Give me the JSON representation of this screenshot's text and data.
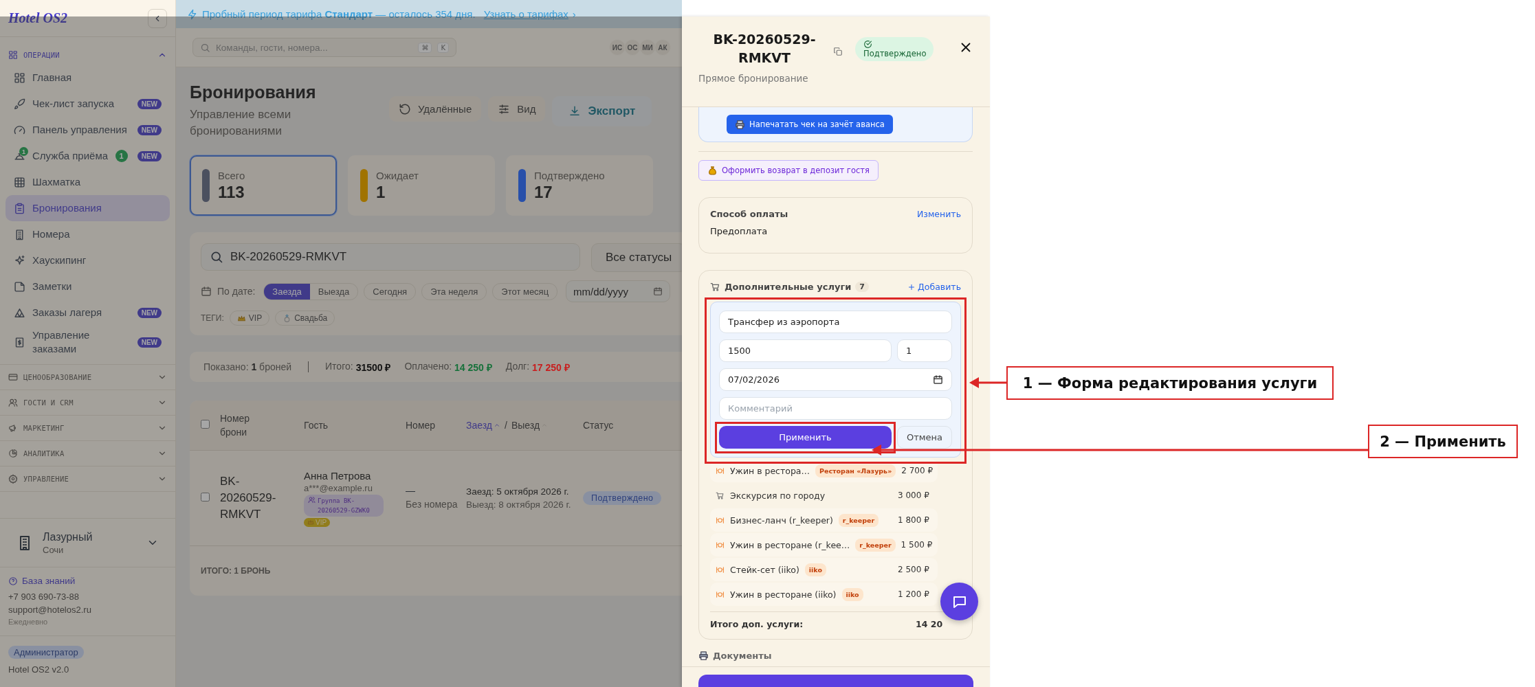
{
  "sidebar": {
    "logo": "Hotel OS2",
    "sections": [
      {
        "title": "ОПЕРАЦИИ",
        "expanded": true,
        "items": [
          {
            "label": "Главная",
            "selected": false
          },
          {
            "label": "Чек-лист запуска",
            "selected": false,
            "badge": "NEW"
          },
          {
            "label": "Панель управления",
            "selected": false,
            "badge": "NEW"
          },
          {
            "label": "Служба приёма",
            "selected": false,
            "icon_count": "1",
            "count": "1",
            "badge": "NEW"
          },
          {
            "label": "Шахматка",
            "selected": false
          },
          {
            "label": "Бронирования",
            "selected": true
          },
          {
            "label": "Номера",
            "selected": false
          },
          {
            "label": "Хаускипинг",
            "selected": false
          },
          {
            "label": "Заметки",
            "selected": false
          },
          {
            "label": "Заказы лагеря",
            "selected": false,
            "badge": "NEW"
          },
          {
            "label": "Управление заказами",
            "selected": false,
            "badge": "NEW"
          }
        ]
      },
      {
        "title": "ЦЕНООБРАЗОВАНИЕ",
        "expanded": false
      },
      {
        "title": "ГОСТИ И CRM",
        "expanded": false
      },
      {
        "title": "МАРКЕТИНГ",
        "expanded": false
      },
      {
        "title": "АНАЛИТИКА",
        "expanded": false
      },
      {
        "title": "УПРАВЛЕНИЕ",
        "expanded": false
      }
    ],
    "hotel": {
      "name": "Лазурный",
      "city": "Сочи"
    },
    "support": {
      "link": "База знаний",
      "phone": "+7 903 690-73-88",
      "email": "support@hotelos2.ru",
      "hours": "Ежедневно"
    },
    "role": "Администратор",
    "version": "Hotel OS2 v2.0"
  },
  "banner": {
    "text": "Пробный период тарифа **Стандарт** — осталось 354 дня.",
    "link": "Узнать о тарифах",
    "link_arrow": "›"
  },
  "topbar": {
    "search_placeholder": "Команды, гости, номера...",
    "shortcut": [
      "⌘",
      "K"
    ],
    "avatars": [
      "ИС",
      "ОС",
      "МИ",
      "АК"
    ]
  },
  "page": {
    "title": "Бронирования",
    "subtitle": "Управление всеми бронированиями",
    "actions": [
      {
        "label": "Удалённые",
        "kind": "secondary"
      },
      {
        "label": "Вид",
        "kind": "secondary"
      },
      {
        "label": "Экспорт",
        "kind": "primary"
      }
    ]
  },
  "stats": [
    {
      "label": "Всего",
      "value": "113",
      "color": "#4b505f",
      "selected": true
    },
    {
      "label": "Ожидает",
      "value": "1",
      "color": "#a07300",
      "selected": false
    },
    {
      "label": "Подтверждено",
      "value": "17",
      "color": "#2850aa",
      "selected": false
    }
  ],
  "filters": {
    "search_value": "BK-20260529-RMKVT",
    "status_select": "Все статусы",
    "date_label": "По дате:",
    "date_modes": [
      {
        "label": "Заезда",
        "selected": true
      },
      {
        "label": "Выезда",
        "selected": false
      }
    ],
    "quick_ranges": [
      {
        "label": "Сегодня",
        "selected": false
      },
      {
        "label": "Эта неделя",
        "selected": false
      },
      {
        "label": "Этот месяц",
        "selected": false
      }
    ],
    "date_placeholder": "mm/dd/yyyy",
    "tags_label": "ТЕГИ:",
    "tags": [
      "VIP",
      "Свадьба"
    ]
  },
  "summary": {
    "shown": "Показано: **1** броней",
    "totals": [
      {
        "label": "Итого:",
        "value": "31500 ₽",
        "color": "#111111"
      },
      {
        "label": "Оплачено:",
        "value": "14 250 ₽",
        "color": "#16713a"
      },
      {
        "label": "Долг:",
        "value": "17 250 ₽",
        "color": "#c81e1e"
      }
    ]
  },
  "table": {
    "select_all": {
      "checked": false
    },
    "columns": [
      "Номер брони",
      "Гость",
      "Номер"
    ],
    "date_sort": {
      "columns": [
        {
          "label": "Заезд",
          "selected": true
        },
        {
          "label": "Выезд",
          "selected": false
        }
      ],
      "separator": "/"
    },
    "status_column": "Статус",
    "rows": [
      {
        "checked": false,
        "booking": "BK-20260529-RMKVT",
        "guest": "Анна Петрова",
        "email": "a***@example.ru",
        "group": "Группа BK-20260529-GZWK0",
        "tags": [
          "VIP"
        ],
        "room": "—",
        "room_note": "Без номера",
        "checkin": "Заезд: 5 октября 2026 г.",
        "checkout": "Выезд: 8 октября 2026 г.",
        "status": "Подтверждено"
      }
    ],
    "footer": "ИТОГО: 1 БРОНЬ"
  },
  "drawer": {
    "title": "BK-20260529-RMKVT",
    "status": "Подтверждено",
    "subtitle": "Прямое бронирование",
    "print_button": "Напечатать чек на зачёт аванса",
    "refund_button": "Оформить возврат в депозит гостя",
    "payment": {
      "title": "Способ оплаты",
      "action": "Изменить",
      "value": "Предоплата"
    },
    "services": {
      "title": "Дополнительные услуги",
      "count": "7",
      "add": "Добавить",
      "edit_form": {
        "name": "Трансфер из аэропорта",
        "price": "1500",
        "quantity": "1",
        "date": "07/02/2026",
        "comment_placeholder": "Комментарий",
        "apply": "Применить",
        "cancel": "Отмена"
      },
      "items": [
        {
          "kind": "restaurant",
          "name": "Ужин в рестора…",
          "tag": "Ресторан «Лазурь»",
          "price": "2 700 ₽"
        },
        {
          "kind": "cart",
          "name": "Экскурсия по городу",
          "price": "3 000 ₽"
        },
        {
          "kind": "restaurant",
          "name": "Бизнес-ланч (r_keeper)",
          "tag": "r_keeper",
          "price": "1 800 ₽"
        },
        {
          "kind": "restaurant",
          "name": "Ужин в ресторане (r_kee…",
          "tag": "r_keeper",
          "price": "1 500 ₽"
        },
        {
          "kind": "restaurant",
          "name": "Стейк-сет (iiko)",
          "tag": "iiko",
          "price": "2 500 ₽"
        },
        {
          "kind": "restaurant",
          "name": "Ужин в ресторане (iiko)",
          "tag": "iiko",
          "price": "1 200 ₽"
        }
      ],
      "total_label": "Итого доп. услуги:",
      "total_value": "14 20"
    },
    "documents": "Документы"
  },
  "annotations": [
    {
      "label": "1 — Форма редактирования услуги"
    },
    {
      "label": "2 — Применить"
    }
  ]
}
